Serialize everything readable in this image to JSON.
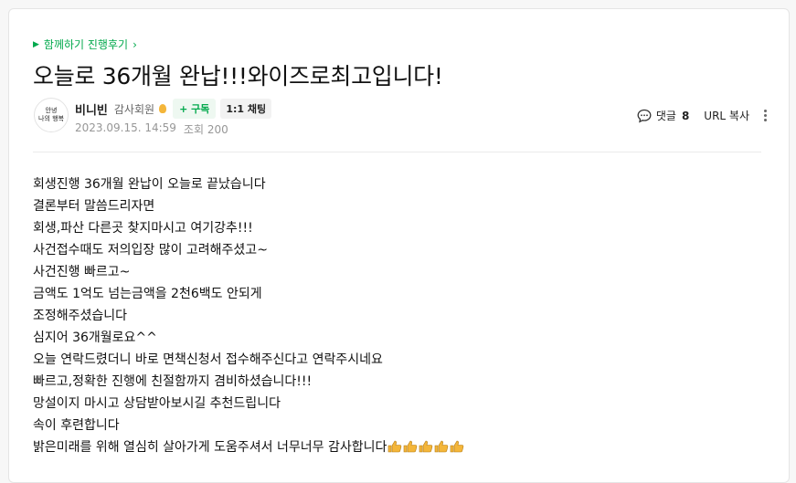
{
  "post": {
    "category": "함께하기 진행후기",
    "title": "오늘로 36개월 완납!!!와이즈로최고입니다!",
    "author": {
      "avatar_text": [
        "안녕",
        "나의 행복"
      ],
      "name": "비니빈",
      "grade": "감사회원",
      "subscribe_label": "+ 구독",
      "chat_label": "1:1 채팅"
    },
    "date": "2023.09.15. 14:59",
    "views": "조회 200",
    "tools": {
      "comment_label": "댓글",
      "comment_count": "8",
      "url_copy": "URL 복사"
    },
    "content": [
      "회생진행 36개월 완납이 오늘로 끝났습니다",
      "결론부터 말씀드리자면",
      "회생,파산 다른곳 찾지마시고 여기강추!!!",
      "사건접수때도 저의입장 많이 고려해주셨고~",
      "사건진행 빠르고~",
      "금액도 1억도 넘는금액을 2천6백도 안되게",
      "조정해주셨습니다",
      "심지어 36개월로요^^",
      "오늘 연락드렸더니 바로 면책신청서 접수해주신다고 연락주시네요",
      "빠르고,정확한 진행에 친절함까지 겸비하셨습니다!!!",
      "망설이지 마시고 상담받아보시길 추천드립니다",
      "속이 후련합니다",
      "밝은미래를 위해 열심히 살아가게 도움주셔서 너무너무 감사합니다"
    ],
    "thumbs_count": 5,
    "colors": {
      "accent": "#03a94d",
      "thumb": "#f4b63a"
    },
    "icons": [
      "play-triangle-icon",
      "chevron-right-icon",
      "grade-medal-icon",
      "comment-icon",
      "more-vertical-icon",
      "thumbs-up-icon"
    ]
  }
}
